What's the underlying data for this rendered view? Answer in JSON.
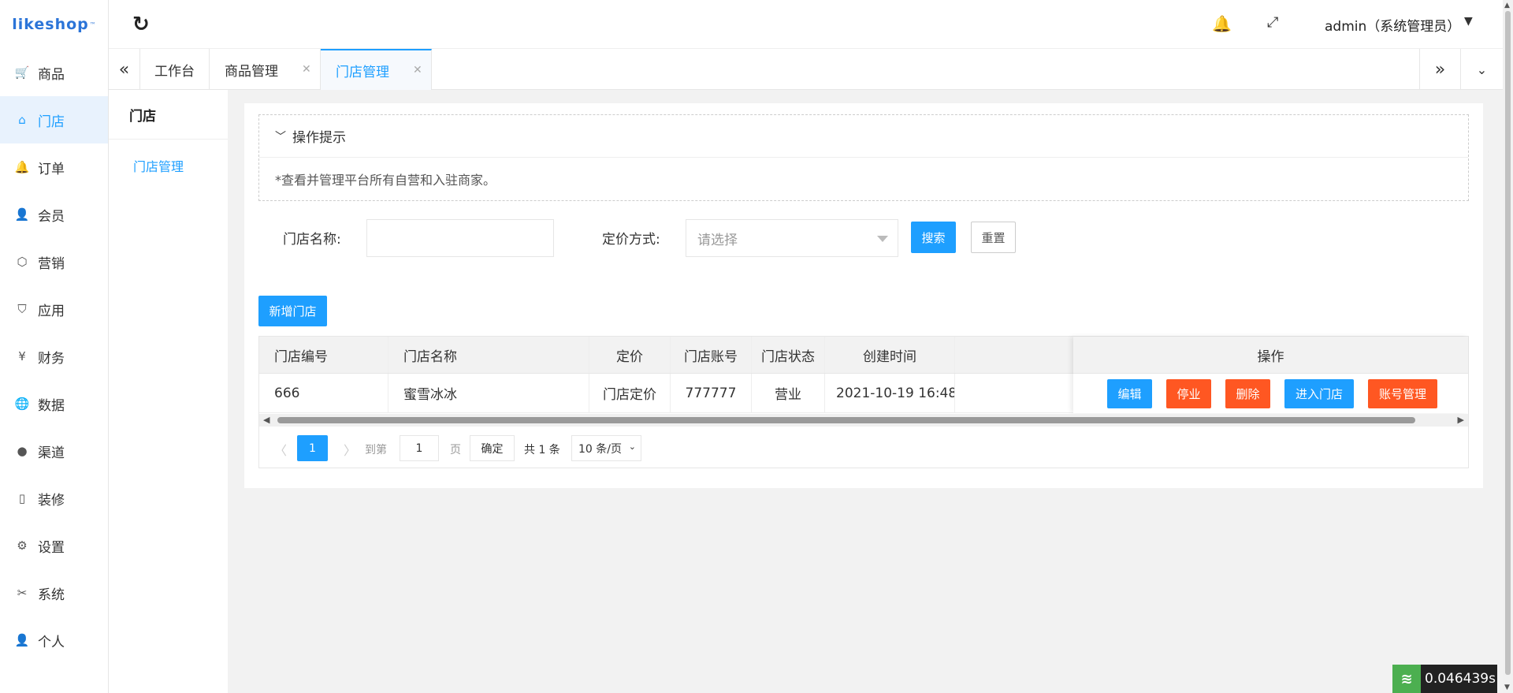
{
  "brand": {
    "name": "likeshop",
    "tm": "™"
  },
  "sidebar": {
    "items": [
      {
        "label": "商品",
        "icon": "cart-icon"
      },
      {
        "label": "门店",
        "icon": "home-icon"
      },
      {
        "label": "订单",
        "icon": "bell-icon"
      },
      {
        "label": "会员",
        "icon": "user-icon"
      },
      {
        "label": "营销",
        "icon": "cube-icon"
      },
      {
        "label": "应用",
        "icon": "shield-icon"
      },
      {
        "label": "财务",
        "icon": "yen-icon"
      },
      {
        "label": "数据",
        "icon": "globe-icon"
      },
      {
        "label": "渠道",
        "icon": "wechat-icon"
      },
      {
        "label": "装修",
        "icon": "tablet-icon"
      },
      {
        "label": "设置",
        "icon": "gear-icon"
      },
      {
        "label": "系统",
        "icon": "tools-icon"
      },
      {
        "label": "个人",
        "icon": "person-icon"
      }
    ],
    "active_index": 1
  },
  "header": {
    "admin_label": "admin（系统管理员）"
  },
  "tabs": [
    {
      "label": "工作台",
      "closable": false
    },
    {
      "label": "商品管理",
      "closable": true
    },
    {
      "label": "门店管理",
      "closable": true,
      "active": true
    }
  ],
  "submenu": {
    "title": "门店",
    "items": [
      {
        "label": "门店管理"
      }
    ]
  },
  "tips": {
    "title": "操作提示",
    "text": "*查看并管理平台所有自营和入驻商家。"
  },
  "filters": {
    "name_label": "门店名称:",
    "name_value": "",
    "pricing_label": "定价方式:",
    "pricing_placeholder": "请选择",
    "search_button": "搜索",
    "reset_button": "重置"
  },
  "add_button": "新增门店",
  "table": {
    "columns": [
      "门店编号",
      "门店名称",
      "定价",
      "门店账号",
      "门店状态",
      "创建时间",
      "操作"
    ],
    "rows": [
      {
        "id": "666",
        "name": "蜜雪冰冰",
        "pricing": "门店定价",
        "account": "777777",
        "status": "营业",
        "created": "2021-10-19 16:48"
      }
    ],
    "actions": [
      "编辑",
      "停业",
      "删除",
      "进入门店",
      "账号管理"
    ]
  },
  "pagination": {
    "current": "1",
    "goto_label": "到第",
    "goto_value": "1",
    "page_unit": "页",
    "confirm": "确定",
    "total": "共 1 条",
    "page_size": "10 条/页"
  },
  "timer": {
    "value": "0.046439s"
  },
  "colors": {
    "primary": "#1e9fff",
    "danger": "#ff5722"
  }
}
